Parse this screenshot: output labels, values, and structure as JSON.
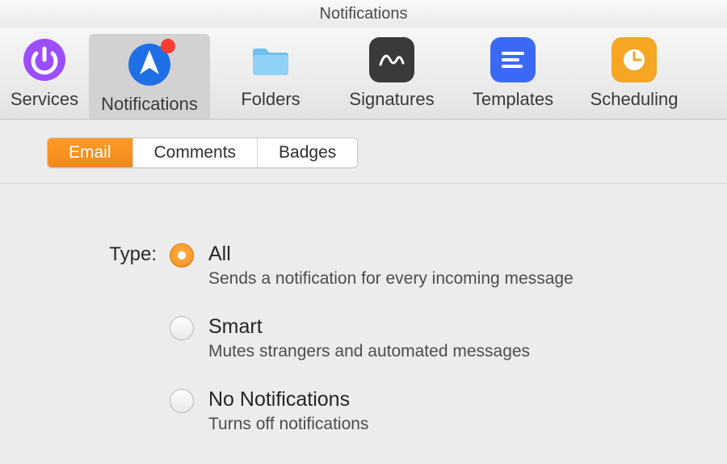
{
  "window": {
    "title": "Notifications"
  },
  "toolbar": {
    "items": [
      {
        "id": "services",
        "label": "Services",
        "icon": "power-icon",
        "selected": false
      },
      {
        "id": "notifications",
        "label": "Notifications",
        "icon": "send-icon",
        "selected": true,
        "badge": true
      },
      {
        "id": "folders",
        "label": "Folders",
        "icon": "folder-icon",
        "selected": false
      },
      {
        "id": "signatures",
        "label": "Signatures",
        "icon": "signature-icon",
        "selected": false
      },
      {
        "id": "templates",
        "label": "Templates",
        "icon": "template-icon",
        "selected": false
      },
      {
        "id": "scheduling",
        "label": "Scheduling",
        "icon": "clock-icon",
        "selected": false
      }
    ]
  },
  "subtabs": {
    "items": [
      {
        "id": "email",
        "label": "Email",
        "active": true
      },
      {
        "id": "comments",
        "label": "Comments",
        "active": false
      },
      {
        "id": "badges",
        "label": "Badges",
        "active": false
      }
    ]
  },
  "type_section": {
    "heading": "Type:",
    "options": [
      {
        "id": "all",
        "title": "All",
        "desc": "Sends a notification for every incoming message",
        "selected": true
      },
      {
        "id": "smart",
        "title": "Smart",
        "desc": "Mutes strangers and automated messages",
        "selected": false
      },
      {
        "id": "none",
        "title": "No Notifications",
        "desc": "Turns off notifications",
        "selected": false
      }
    ]
  },
  "colors": {
    "accent_orange": "#f28c1a",
    "icon_purple": "#9b4dff",
    "icon_blue_light": "#6fc0f0",
    "icon_blue_nav": "#1f6fe6",
    "icon_dark": "#3a3a3a",
    "icon_template_blue": "#3a6af5",
    "badge_red": "#ff3b30"
  }
}
